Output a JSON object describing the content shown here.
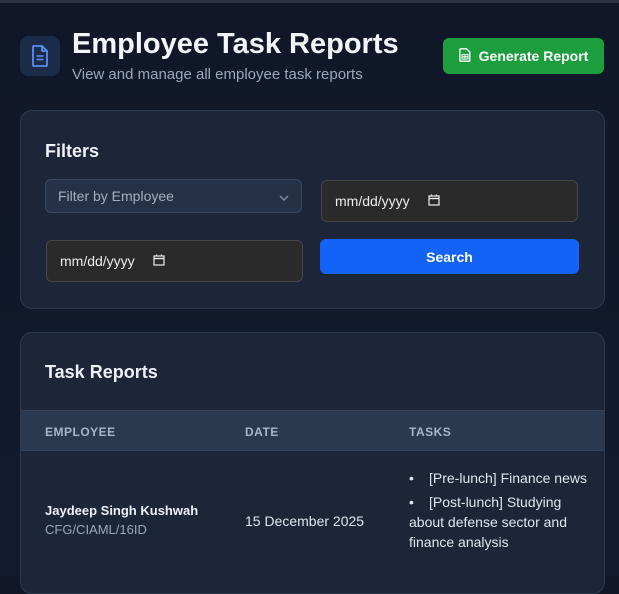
{
  "header": {
    "title": "Employee Task Reports",
    "subtitle": "View and manage all employee task reports",
    "generate_label": "Generate Report",
    "icon": "document-icon"
  },
  "filters": {
    "title": "Filters",
    "employee_placeholder": "Filter by Employee",
    "start_date": "mm/dd/yyyy",
    "end_date": "mm/dd/yyyy",
    "search_label": "Search"
  },
  "reports": {
    "title": "Task Reports",
    "columns": [
      "EMPLOYEE",
      "DATE",
      "TASKS"
    ],
    "rows": [
      {
        "employee_name": "Jaydeep Singh Kushwah",
        "employee_id": "CFG/CIAML/16ID",
        "date": "15 December 2025",
        "tasks": [
          "[Pre-lunch] Finance news",
          "[Post-lunch] Studying about defense sector and finance analysis"
        ]
      }
    ]
  },
  "colors": {
    "accent_green": "#1c9e3f",
    "accent_blue": "#1463f8",
    "card_bg": "#1c2638"
  }
}
